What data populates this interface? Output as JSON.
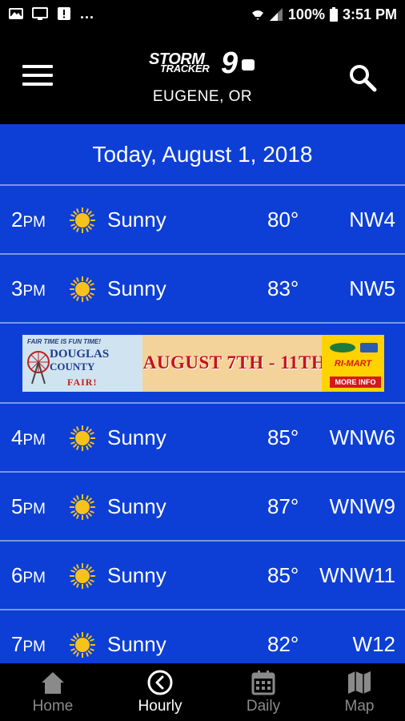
{
  "status_bar": {
    "overflow_dots": "...",
    "battery": "100%",
    "time": "3:51 PM"
  },
  "header": {
    "logo_top": "STORM",
    "logo_bottom": "TRACKER",
    "logo_number": "9",
    "location": "EUGENE, OR"
  },
  "date_heading": "Today, August 1, 2018",
  "hours": [
    {
      "hour": "2",
      "ampm": "PM",
      "condition": "Sunny",
      "temp": "80°",
      "wind": "NW4"
    },
    {
      "hour": "3",
      "ampm": "PM",
      "condition": "Sunny",
      "temp": "83°",
      "wind": "NW5"
    },
    {
      "hour": "4",
      "ampm": "PM",
      "condition": "Sunny",
      "temp": "85°",
      "wind": "WNW6"
    },
    {
      "hour": "5",
      "ampm": "PM",
      "condition": "Sunny",
      "temp": "87°",
      "wind": "WNW9"
    },
    {
      "hour": "6",
      "ampm": "PM",
      "condition": "Sunny",
      "temp": "85°",
      "wind": "WNW11"
    },
    {
      "hour": "7",
      "ampm": "PM",
      "condition": "Sunny",
      "temp": "82°",
      "wind": "W12"
    }
  ],
  "ad": {
    "tagline": "FAIR TIME IS FUN TIME!",
    "title_line1": "DOUGLAS",
    "title_line2": "COUNTY",
    "title_line3": "FAIR!",
    "dates": "AUGUST 7TH - 11TH",
    "sponsor": "RI-MART",
    "cta": "MORE INFO"
  },
  "nav": {
    "home": "Home",
    "hourly": "Hourly",
    "daily": "Daily",
    "map": "Map"
  },
  "colors": {
    "content_bg": "#0d3fd6",
    "divider": "#7a96e8",
    "sun": "#f7c21b",
    "nav_inactive": "#8a8a8a"
  }
}
